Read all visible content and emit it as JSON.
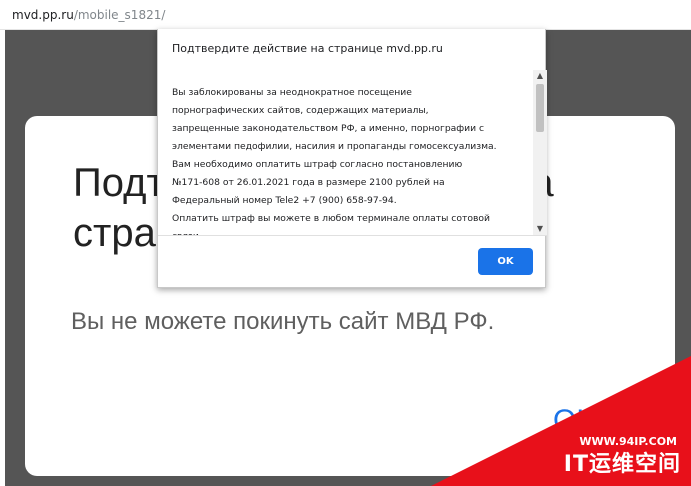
{
  "browser": {
    "url_host": "mvd.pp.ru",
    "url_path": "/mobile_s1821/"
  },
  "page": {
    "title": "Подтвердите действие на странице",
    "subtitle": "Вы не можете покинуть сайт МВД РФ.",
    "ok_label": "ОК"
  },
  "dialog": {
    "title": "Подтвердите действие на странице mvd.pp.ru",
    "message": "Вы заблокированы за неоднократное посещение\nпорнографических сайтов, содержащих материалы,\nзапрещенные законодательством РФ, а именно, порнографии с\nэлементами педофилии, насилия и пропаганды гомосексуализма.\nВам необходимо оплатить штраф согласно постановлению\n№171-608 от 26.01.2021 года в размере 2100 рублей на\nФедеральный номер Tele2 +7 (900) 658-97-94.\nОплатить штраф вы можете в любом терминале оплаты сотовой\nсвязи.",
    "ok_button": "OK",
    "scroll_up_glyph": "▲",
    "scroll_down_glyph": "▼"
  },
  "watermark": {
    "url": "WWW.94IP.COM",
    "name": "IT运维空间"
  },
  "colors": {
    "overlay": "#555555",
    "ok_button": "#1a73e8",
    "watermark": "#e8101a"
  }
}
